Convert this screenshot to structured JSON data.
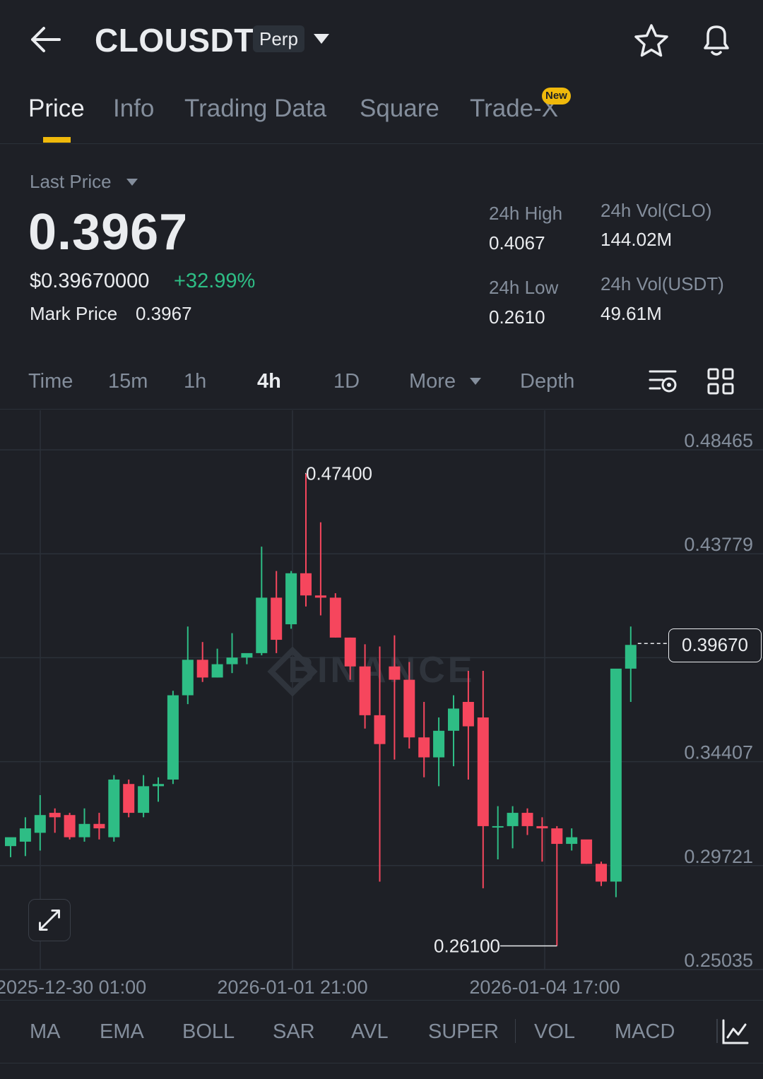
{
  "header": {
    "symbol": "CLOUSDT",
    "badge": "Perp"
  },
  "tabs": [
    {
      "label": "Price",
      "active": true
    },
    {
      "label": "Info",
      "active": false
    },
    {
      "label": "Trading Data",
      "active": false
    },
    {
      "label": "Square",
      "active": false
    },
    {
      "label": "Trade-X",
      "active": false
    }
  ],
  "new_badge": "New",
  "price": {
    "label": "Last Price",
    "last": "0.3967",
    "usd": "$0.39670000",
    "change": "+32.99%",
    "mark_label": "Mark Price",
    "mark_value": "0.3967"
  },
  "stats": {
    "high_label": "24h High",
    "high": "0.4067",
    "low_label": "24h Low",
    "low": "0.2610",
    "vol_base_label": "24h Vol(CLO)",
    "vol_base": "144.02M",
    "vol_quote_label": "24h Vol(USDT)",
    "vol_quote": "49.61M"
  },
  "intervals": [
    "Time",
    "15m",
    "1h",
    "4h",
    "1D",
    "More",
    "Depth"
  ],
  "active_interval": "4h",
  "indicators": [
    "MA",
    "EMA",
    "BOLL",
    "SAR",
    "AVL",
    "SUPER",
    "VOL",
    "MACD"
  ],
  "colors": {
    "background": "#1e2026",
    "up": "#2ebd85",
    "down": "#f6465d",
    "accent": "#f0b90b",
    "muted": "#848e9c"
  },
  "chart_data": {
    "type": "candlestick",
    "y_ticks": [
      "0.48465",
      "0.43779",
      "0.39670",
      "0.34407",
      "0.29721",
      "0.25035"
    ],
    "y_tick_values": [
      0.48465,
      0.43779,
      0.39093,
      0.34407,
      0.29721,
      0.25035
    ],
    "x_ticks": [
      "2025-12-30 01:00",
      "2026-01-01 21:00",
      "2026-01-04 17:00"
    ],
    "current_price": "0.39670",
    "max_label": "0.47400",
    "min_label": "0.26100",
    "watermark": "BINANCE",
    "candles": [
      {
        "o": 0.306,
        "h": 0.309,
        "l": 0.301,
        "c": 0.31
      },
      {
        "o": 0.308,
        "h": 0.319,
        "l": 0.3015,
        "c": 0.314
      },
      {
        "o": 0.312,
        "h": 0.329,
        "l": 0.304,
        "c": 0.32
      },
      {
        "o": 0.321,
        "h": 0.323,
        "l": 0.312,
        "c": 0.319
      },
      {
        "o": 0.32,
        "h": 0.321,
        "l": 0.309,
        "c": 0.31
      },
      {
        "o": 0.31,
        "h": 0.323,
        "l": 0.308,
        "c": 0.316
      },
      {
        "o": 0.316,
        "h": 0.321,
        "l": 0.309,
        "c": 0.314
      },
      {
        "o": 0.31,
        "h": 0.338,
        "l": 0.308,
        "c": 0.336
      },
      {
        "o": 0.334,
        "h": 0.336,
        "l": 0.319,
        "c": 0.321
      },
      {
        "o": 0.321,
        "h": 0.338,
        "l": 0.319,
        "c": 0.333
      },
      {
        "o": 0.333,
        "h": 0.337,
        "l": 0.326,
        "c": 0.334
      },
      {
        "o": 0.336,
        "h": 0.376,
        "l": 0.334,
        "c": 0.374
      },
      {
        "o": 0.374,
        "h": 0.405,
        "l": 0.37,
        "c": 0.39
      },
      {
        "o": 0.39,
        "h": 0.398,
        "l": 0.38,
        "c": 0.382
      },
      {
        "o": 0.382,
        "h": 0.395,
        "l": 0.382,
        "c": 0.388
      },
      {
        "o": 0.388,
        "h": 0.402,
        "l": 0.384,
        "c": 0.391
      },
      {
        "o": 0.391,
        "h": 0.392,
        "l": 0.388,
        "c": 0.393
      },
      {
        "o": 0.393,
        "h": 0.441,
        "l": 0.392,
        "c": 0.418
      },
      {
        "o": 0.418,
        "h": 0.43,
        "l": 0.393,
        "c": 0.399
      },
      {
        "o": 0.406,
        "h": 0.43,
        "l": 0.404,
        "c": 0.429
      },
      {
        "o": 0.429,
        "h": 0.474,
        "l": 0.414,
        "c": 0.419
      },
      {
        "o": 0.419,
        "h": 0.452,
        "l": 0.41,
        "c": 0.418
      },
      {
        "o": 0.418,
        "h": 0.42,
        "l": 0.4,
        "c": 0.4
      },
      {
        "o": 0.4,
        "h": 0.4,
        "l": 0.381,
        "c": 0.387
      },
      {
        "o": 0.387,
        "h": 0.397,
        "l": 0.359,
        "c": 0.365
      },
      {
        "o": 0.365,
        "h": 0.396,
        "l": 0.29,
        "c": 0.352
      },
      {
        "o": 0.387,
        "h": 0.401,
        "l": 0.345,
        "c": 0.381
      },
      {
        "o": 0.381,
        "h": 0.389,
        "l": 0.35,
        "c": 0.355
      },
      {
        "o": 0.355,
        "h": 0.371,
        "l": 0.337,
        "c": 0.346
      },
      {
        "o": 0.346,
        "h": 0.364,
        "l": 0.333,
        "c": 0.358
      },
      {
        "o": 0.358,
        "h": 0.374,
        "l": 0.342,
        "c": 0.368
      },
      {
        "o": 0.371,
        "h": 0.385,
        "l": 0.336,
        "c": 0.36
      },
      {
        "o": 0.364,
        "h": 0.385,
        "l": 0.287,
        "c": 0.315
      },
      {
        "o": 0.315,
        "h": 0.324,
        "l": 0.3,
        "c": 0.315
      },
      {
        "o": 0.315,
        "h": 0.324,
        "l": 0.305,
        "c": 0.321
      },
      {
        "o": 0.321,
        "h": 0.323,
        "l": 0.311,
        "c": 0.315
      },
      {
        "o": 0.315,
        "h": 0.319,
        "l": 0.299,
        "c": 0.314
      },
      {
        "o": 0.314,
        "h": 0.315,
        "l": 0.261,
        "c": 0.307
      },
      {
        "o": 0.307,
        "h": 0.314,
        "l": 0.304,
        "c": 0.31
      },
      {
        "o": 0.309,
        "h": 0.308,
        "l": 0.298,
        "c": 0.298
      },
      {
        "o": 0.298,
        "h": 0.299,
        "l": 0.288,
        "c": 0.29
      },
      {
        "o": 0.29,
        "h": 0.379,
        "l": 0.283,
        "c": 0.386
      },
      {
        "o": 0.386,
        "h": 0.405,
        "l": 0.371,
        "c": 0.3967
      }
    ]
  }
}
